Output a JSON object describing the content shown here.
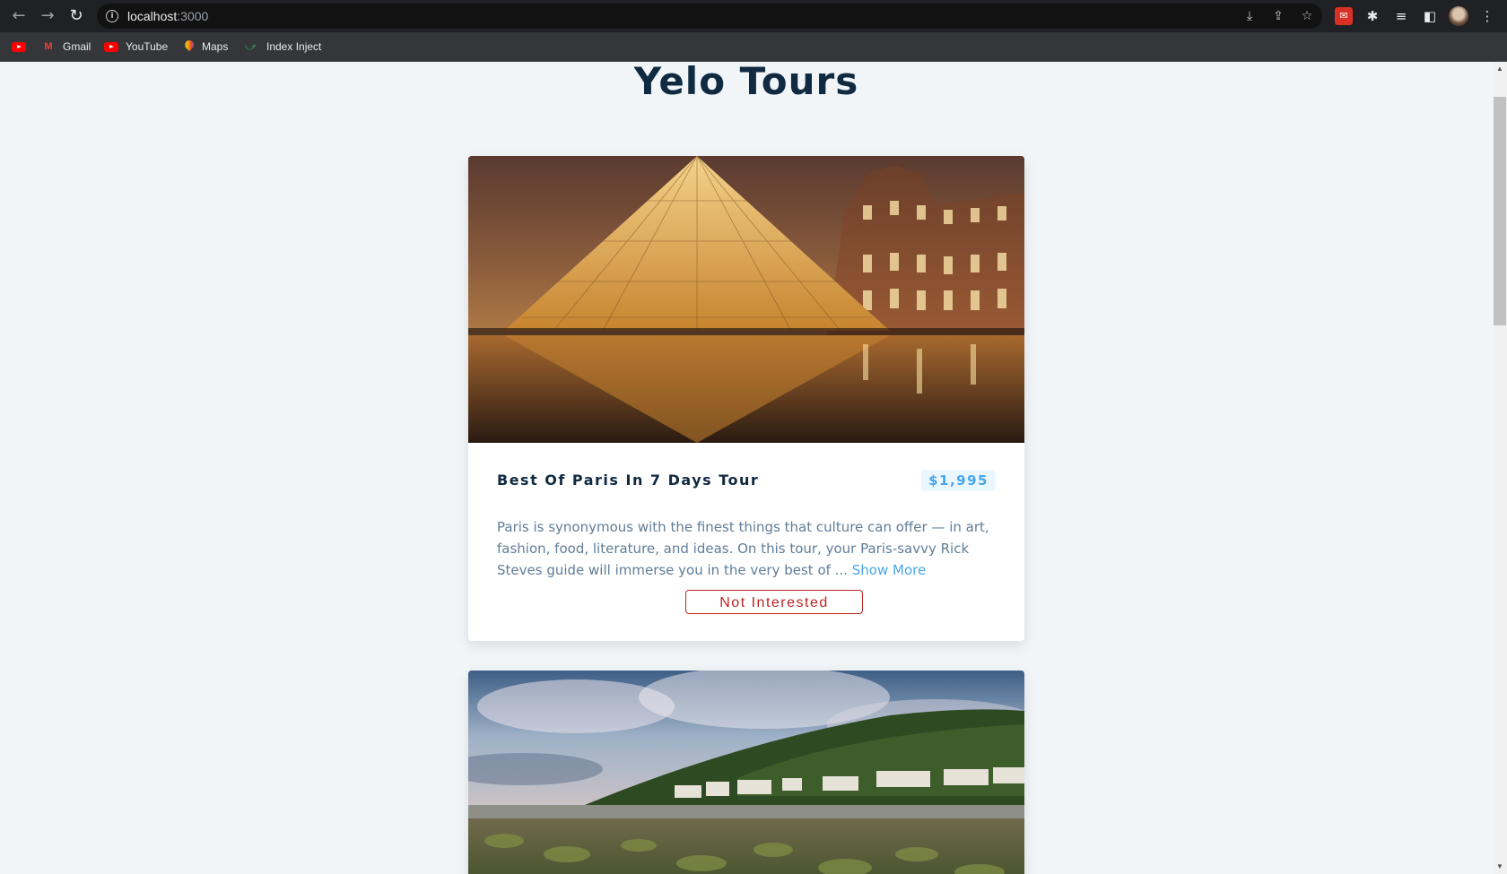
{
  "browser": {
    "url_host": "localhost",
    "url_port": ":3000",
    "bookmarks": [
      {
        "label": ""
      },
      {
        "label": "Gmail"
      },
      {
        "label": "YouTube"
      },
      {
        "label": "Maps"
      },
      {
        "label": "Index Inject"
      }
    ]
  },
  "page": {
    "title": "Yelo Tours"
  },
  "tours": [
    {
      "name": "Best Of Paris In 7 Days Tour",
      "price": "$1,995",
      "info": "Paris is synonymous with the finest things that culture can offer — in art, fashion, food, literature, and ideas. On this tour, your Paris-savvy Rick Steves guide will immerse you in the very best of ...",
      "show_more_label": "Show More",
      "not_interested_label": "Not Interested"
    }
  ],
  "colors": {
    "page_bg": "#f1f5f8",
    "title": "#102a42",
    "accent": "#49a6e9",
    "danger": "#bb2525",
    "text_muted": "#617d98"
  }
}
